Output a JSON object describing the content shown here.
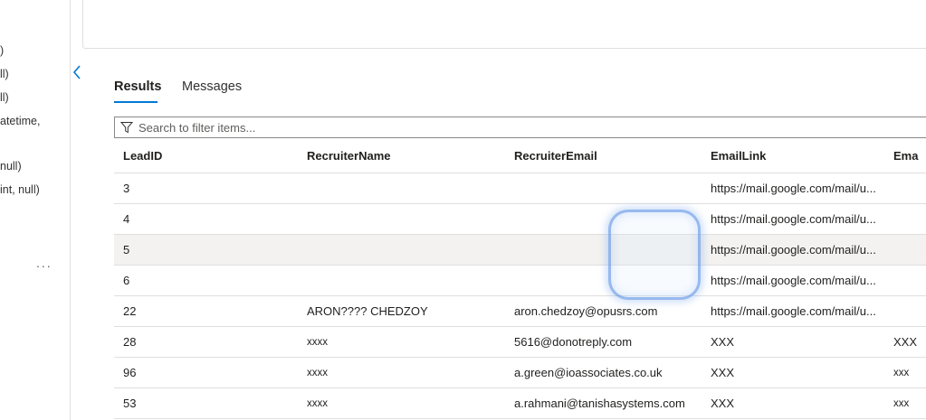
{
  "left_tree": {
    "lines": [
      ")",
      "ll)",
      "ll)",
      "atetime,",
      "null)",
      "int, null)"
    ],
    "more": "..."
  },
  "tabs": [
    {
      "label": "Results",
      "active": true
    },
    {
      "label": "Messages",
      "active": false
    }
  ],
  "filter": {
    "placeholder": "Search to filter items..."
  },
  "grid": {
    "columns": [
      "LeadID",
      "RecruiterName",
      "RecruiterEmail",
      "EmailLink",
      "Ema"
    ],
    "rows": [
      {
        "LeadID": "3",
        "RecruiterName": "",
        "RecruiterEmail": "",
        "EmailLink": "https://mail.google.com/mail/u...",
        "Ema": ""
      },
      {
        "LeadID": "4",
        "RecruiterName": "",
        "RecruiterEmail": "",
        "EmailLink": "https://mail.google.com/mail/u...",
        "Ema": ""
      },
      {
        "LeadID": "5",
        "RecruiterName": "",
        "RecruiterEmail": "",
        "EmailLink": "https://mail.google.com/mail/u...",
        "Ema": ""
      },
      {
        "LeadID": "6",
        "RecruiterName": "",
        "RecruiterEmail": "",
        "EmailLink": "https://mail.google.com/mail/u...",
        "Ema": ""
      },
      {
        "LeadID": "22",
        "RecruiterName": "ARON???? CHEDZOY",
        "RecruiterEmail": "aron.chedzoy@opusrs.com",
        "EmailLink": "https://mail.google.com/mail/u...",
        "Ema": ""
      },
      {
        "LeadID": "28",
        "RecruiterName": "xxxx",
        "RecruiterEmail": "5616@donotreply.com",
        "EmailLink": "XXX",
        "Ema": "XXX"
      },
      {
        "LeadID": "96",
        "RecruiterName": "xxxx",
        "RecruiterEmail": "a.green@ioassociates.co.uk",
        "EmailLink": "XXX",
        "Ema": "xxx"
      },
      {
        "LeadID": "53",
        "RecruiterName": "xxxx",
        "RecruiterEmail": "a.rahmani@tanishasystems.com",
        "EmailLink": "XXX",
        "Ema": "xxx"
      }
    ],
    "selected_row": 2
  },
  "colors": {
    "accent": "#0078d4",
    "border": "#e1dfdd",
    "selected_row": "#f3f2f1"
  }
}
